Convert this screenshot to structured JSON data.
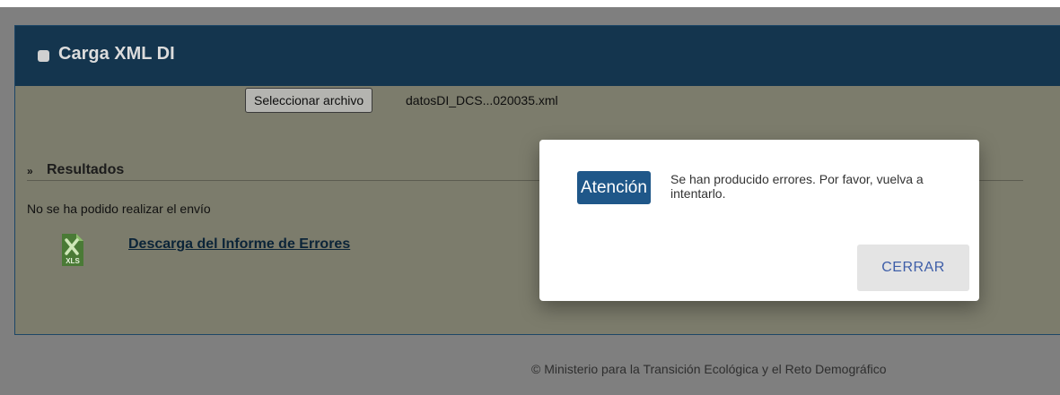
{
  "panel": {
    "title": "Carga XML DI",
    "file_input": {
      "button_label": "Seleccionar archivo",
      "file_name": "datosDI_DCS...020035.xml"
    }
  },
  "results": {
    "arrow": "»",
    "title": "Resultados",
    "status": "No se ha podido realizar el envío",
    "download_link": "Descarga del Informe de Errores",
    "download_icon_text": "XLS"
  },
  "footer": {
    "text": "© Ministerio para la Transición Ecológica y el Reto Demográfico"
  },
  "dialog": {
    "badge": "Atención",
    "message": "Se han producido errores. Por favor, vuelva a intentarlo.",
    "close_label": "CERRAR"
  },
  "colors": {
    "header_bg": "#14354e",
    "badge_bg": "#1f5789",
    "close_text": "#3e5ea8",
    "excel_green": "#3d8b3d"
  },
  "icons": {
    "header": "square-bullet-icon",
    "download": "excel-file-icon"
  }
}
